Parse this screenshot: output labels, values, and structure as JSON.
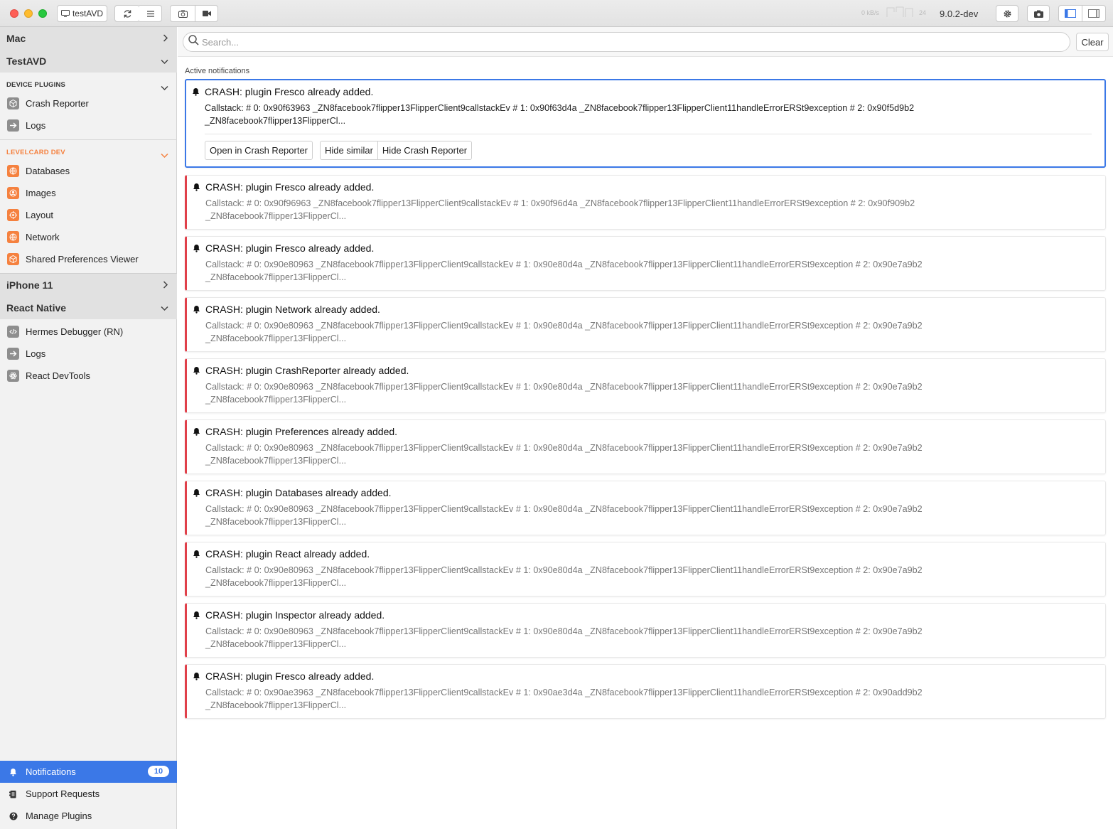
{
  "titlebar": {
    "device_label": "testAVD",
    "net_speed": "0 kB/s",
    "fps": "24",
    "version": "9.0.2-dev"
  },
  "sidebar": {
    "devices": [
      {
        "label": "Mac",
        "expanded": false
      },
      {
        "label": "TestAVD",
        "expanded": true
      },
      {
        "label": "iPhone 11",
        "expanded": false
      },
      {
        "label": "React Native",
        "expanded": true
      }
    ],
    "device_plugins_label": "DEVICE PLUGINS",
    "device_plugins": [
      {
        "label": "Crash Reporter",
        "icon": "cube-icon"
      },
      {
        "label": "Logs",
        "icon": "arrow-right-icon"
      }
    ],
    "app_label": "LEVELCARD DEV",
    "app_plugins": [
      {
        "label": "Databases",
        "icon": "globe-icon"
      },
      {
        "label": "Images",
        "icon": "person-icon"
      },
      {
        "label": "Layout",
        "icon": "target-icon"
      },
      {
        "label": "Network",
        "icon": "globe-icon"
      },
      {
        "label": "Shared Preferences Viewer",
        "icon": "cube-icon"
      }
    ],
    "rn_plugins": [
      {
        "label": "Hermes Debugger (RN)",
        "icon": "code-icon"
      },
      {
        "label": "Logs",
        "icon": "arrow-right-icon"
      },
      {
        "label": "React DevTools",
        "icon": "atom-icon"
      }
    ],
    "footer": {
      "notifications_label": "Notifications",
      "notifications_count": "10",
      "support_label": "Support Requests",
      "manage_label": "Manage Plugins"
    }
  },
  "main": {
    "search_placeholder": "Search...",
    "clear_label": "Clear",
    "active_label": "Active notifications",
    "actions": {
      "open": "Open in Crash Reporter",
      "hide_similar": "Hide similar",
      "hide_reporter": "Hide Crash Reporter"
    },
    "notifications": [
      {
        "title": "CRASH: plugin Fresco already added.",
        "line1": "Callstack: # 0: 0x90f63963 _ZN8facebook7flipper13FlipperClient9callstackEv # 1: 0x90f63d4a _ZN8facebook7flipper13FlipperClient11handleErrorERSt9exception # 2: 0x90f5d9b2",
        "line2": "_ZN8facebook7flipper13FlipperCl..."
      },
      {
        "title": "CRASH: plugin Fresco already added.",
        "line1": "Callstack: # 0: 0x90f96963 _ZN8facebook7flipper13FlipperClient9callstackEv # 1: 0x90f96d4a _ZN8facebook7flipper13FlipperClient11handleErrorERSt9exception # 2: 0x90f909b2",
        "line2": "_ZN8facebook7flipper13FlipperCl..."
      },
      {
        "title": "CRASH: plugin Fresco already added.",
        "line1": "Callstack: # 0: 0x90e80963 _ZN8facebook7flipper13FlipperClient9callstackEv # 1: 0x90e80d4a _ZN8facebook7flipper13FlipperClient11handleErrorERSt9exception # 2: 0x90e7a9b2",
        "line2": "_ZN8facebook7flipper13FlipperCl..."
      },
      {
        "title": "CRASH: plugin Network already added.",
        "line1": "Callstack: # 0: 0x90e80963 _ZN8facebook7flipper13FlipperClient9callstackEv # 1: 0x90e80d4a _ZN8facebook7flipper13FlipperClient11handleErrorERSt9exception # 2: 0x90e7a9b2",
        "line2": "_ZN8facebook7flipper13FlipperCl..."
      },
      {
        "title": "CRASH: plugin CrashReporter already added.",
        "line1": "Callstack: # 0: 0x90e80963 _ZN8facebook7flipper13FlipperClient9callstackEv # 1: 0x90e80d4a _ZN8facebook7flipper13FlipperClient11handleErrorERSt9exception # 2: 0x90e7a9b2",
        "line2": "_ZN8facebook7flipper13FlipperCl..."
      },
      {
        "title": "CRASH: plugin Preferences already added.",
        "line1": "Callstack: # 0: 0x90e80963 _ZN8facebook7flipper13FlipperClient9callstackEv # 1: 0x90e80d4a _ZN8facebook7flipper13FlipperClient11handleErrorERSt9exception # 2: 0x90e7a9b2",
        "line2": "_ZN8facebook7flipper13FlipperCl..."
      },
      {
        "title": "CRASH: plugin Databases already added.",
        "line1": "Callstack: # 0: 0x90e80963 _ZN8facebook7flipper13FlipperClient9callstackEv # 1: 0x90e80d4a _ZN8facebook7flipper13FlipperClient11handleErrorERSt9exception # 2: 0x90e7a9b2",
        "line2": "_ZN8facebook7flipper13FlipperCl..."
      },
      {
        "title": "CRASH: plugin React already added.",
        "line1": "Callstack: # 0: 0x90e80963 _ZN8facebook7flipper13FlipperClient9callstackEv # 1: 0x90e80d4a _ZN8facebook7flipper13FlipperClient11handleErrorERSt9exception # 2: 0x90e7a9b2",
        "line2": "_ZN8facebook7flipper13FlipperCl..."
      },
      {
        "title": "CRASH: plugin Inspector already added.",
        "line1": "Callstack: # 0: 0x90e80963 _ZN8facebook7flipper13FlipperClient9callstackEv # 1: 0x90e80d4a _ZN8facebook7flipper13FlipperClient11handleErrorERSt9exception # 2: 0x90e7a9b2",
        "line2": "_ZN8facebook7flipper13FlipperCl..."
      },
      {
        "title": "CRASH: plugin Fresco already added.",
        "line1": "Callstack: # 0: 0x90ae3963 _ZN8facebook7flipper13FlipperClient9callstackEv # 1: 0x90ae3d4a _ZN8facebook7flipper13FlipperClient11handleErrorERSt9exception # 2: 0x90add9b2",
        "line2": "_ZN8facebook7flipper13FlipperCl..."
      }
    ]
  },
  "colors": {
    "accent": "#3b78e7",
    "crash_red": "#e0404a",
    "app_orange": "#f5813f"
  }
}
